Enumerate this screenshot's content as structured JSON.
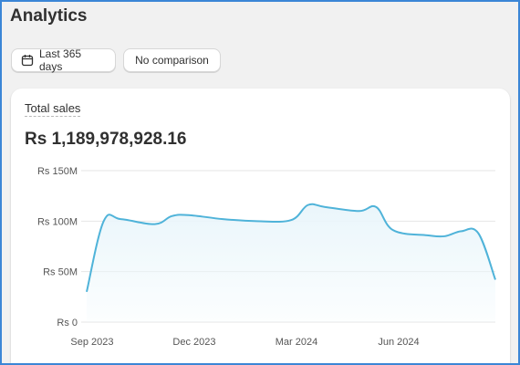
{
  "page": {
    "title": "Analytics"
  },
  "filters": {
    "date_range_label": "Last 365 days",
    "comparison_label": "No comparison"
  },
  "card": {
    "title": "Total sales",
    "value": "Rs 1,189,978,928.16"
  },
  "colors": {
    "line": "#4fb3d9",
    "area": "#eaf6fb",
    "grid": "#e6e6e6",
    "frame": "#3b86d6"
  },
  "chart_data": {
    "type": "area",
    "title": "",
    "xlabel": "",
    "ylabel": "",
    "ylim": [
      0,
      150000000
    ],
    "y_ticks": [
      {
        "value": 0,
        "label": "Rs 0"
      },
      {
        "value": 50000000,
        "label": "Rs 50M"
      },
      {
        "value": 100000000,
        "label": "Rs 100M"
      },
      {
        "value": 150000000,
        "label": "Rs 150M"
      }
    ],
    "x_ticks": [
      "Sep 2023",
      "Dec 2023",
      "Mar 2024",
      "Jun 2024"
    ],
    "x_tick_index": [
      0.16,
      3.16,
      6.16,
      9.16
    ],
    "x": [
      0,
      0.5,
      1,
      2,
      2.5,
      3,
      4,
      5,
      6,
      6.5,
      7,
      8,
      8.5,
      9,
      10,
      10.5,
      11,
      11.5,
      12
    ],
    "y": [
      30000000,
      100000000,
      102000000,
      97000000,
      105000000,
      106000000,
      102000000,
      100000000,
      101000000,
      116000000,
      114000000,
      110000000,
      114000000,
      91000000,
      86000000,
      85000000,
      90000000,
      88000000,
      42000000
    ]
  }
}
